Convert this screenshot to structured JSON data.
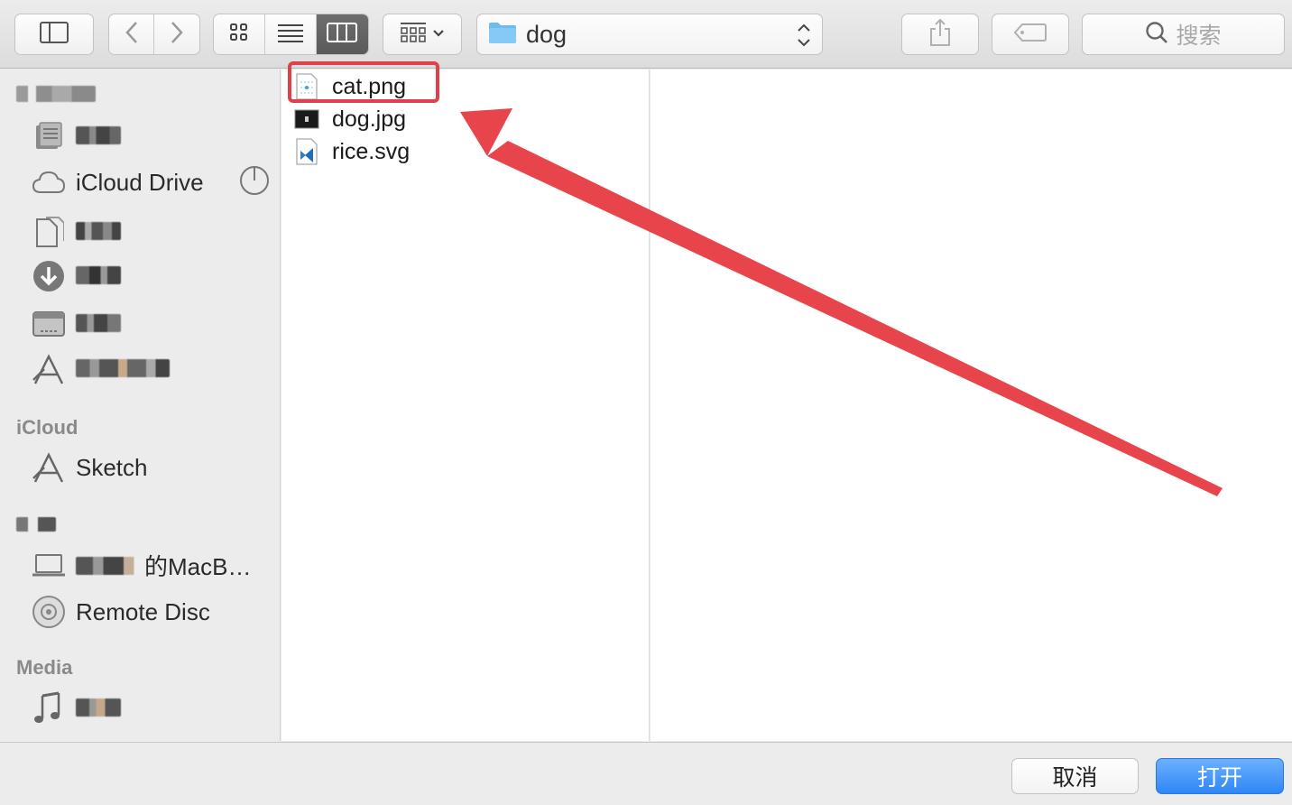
{
  "toolbar": {
    "path": "dog",
    "search_placeholder": "搜索"
  },
  "sidebar": {
    "favorites_header": "",
    "icloud_drive": "iCloud Drive",
    "section_icloud": "iCloud",
    "sketch": "Sketch",
    "macbook": "的MacB…",
    "remote_disc": "Remote Disc",
    "section_media": "Media"
  },
  "files": [
    {
      "name": "cat.png"
    },
    {
      "name": "dog.jpg"
    },
    {
      "name": "rice.svg"
    }
  ],
  "buttons": {
    "cancel": "取消",
    "open": "打开"
  },
  "colors": {
    "accent_blue": "#2f86f5",
    "annotation_red": "#e0404a",
    "folder_blue": "#6cbcf0"
  }
}
